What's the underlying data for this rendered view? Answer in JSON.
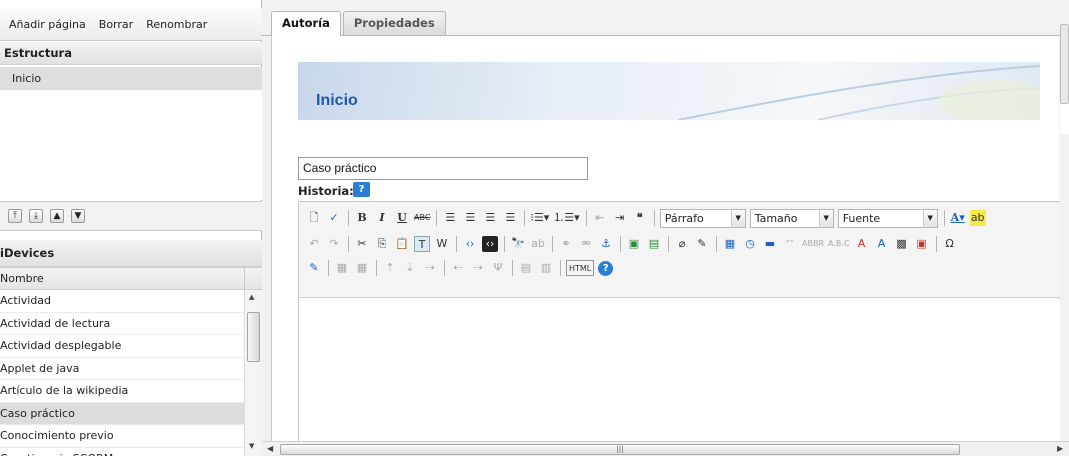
{
  "menu": {
    "add_page": "Añadir página",
    "delete": "Borrar",
    "rename": "Renombrar"
  },
  "structure": {
    "header": "Estructura",
    "items": [
      "Inicio"
    ]
  },
  "move_buttons": [
    "move-top",
    "move-up",
    "move-down",
    "move-bottom"
  ],
  "idevices": {
    "header": "iDevices",
    "column_header": "Nombre",
    "items": [
      "Actividad",
      "Actividad de lectura",
      "Actividad desplegable",
      "Applet de java",
      "Artículo de la wikipedia",
      "Caso práctico",
      "Conocimiento previo",
      "Cuestionario SCORM"
    ],
    "selected": "Caso práctico"
  },
  "tabs": {
    "authoring": "Autoría",
    "properties": "Propiedades"
  },
  "page": {
    "title": "Inicio"
  },
  "idevice_form": {
    "title_value": "Caso práctico",
    "history_label": "Historia:",
    "help_glyph": "?"
  },
  "toolbar": {
    "format_select": "Párrafo",
    "size_select": "Tamaño",
    "font_select": "Fuente",
    "html_label": "HTML"
  },
  "colors": {
    "accent": "#1f5aa8",
    "help_blue": "#2a7fd4",
    "selected_row": "#dcdcdc"
  }
}
